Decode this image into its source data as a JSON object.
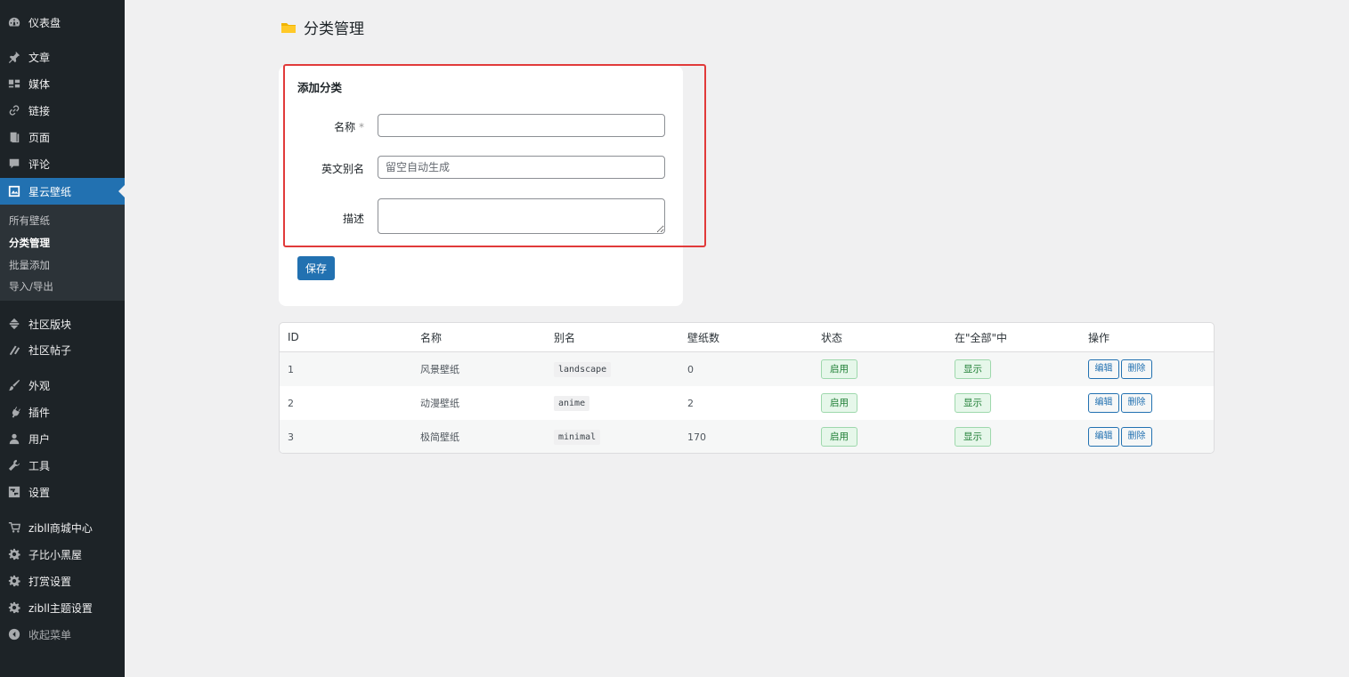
{
  "sidebar": {
    "items": [
      {
        "label": "仪表盘",
        "icon": "dashboard-icon"
      },
      {
        "label": "文章",
        "icon": "pin-icon"
      },
      {
        "label": "媒体",
        "icon": "media-icon"
      },
      {
        "label": "链接",
        "icon": "link-icon"
      },
      {
        "label": "页面",
        "icon": "page-icon"
      },
      {
        "label": "评论",
        "icon": "comment-icon"
      },
      {
        "label": "星云壁纸",
        "icon": "gallery-icon",
        "active": true
      },
      {
        "label": "社区版块",
        "icon": "forum-icon"
      },
      {
        "label": "社区帖子",
        "icon": "posts-icon"
      },
      {
        "label": "外观",
        "icon": "brush-icon"
      },
      {
        "label": "插件",
        "icon": "plugin-icon"
      },
      {
        "label": "用户",
        "icon": "user-icon"
      },
      {
        "label": "工具",
        "icon": "wrench-icon"
      },
      {
        "label": "设置",
        "icon": "settings-icon"
      },
      {
        "label": "zibll商城中心",
        "icon": "cart-icon"
      },
      {
        "label": "子比小黑屋",
        "icon": "gear-icon"
      },
      {
        "label": "打赏设置",
        "icon": "gear-icon"
      },
      {
        "label": "zibll主题设置",
        "icon": "gear-icon"
      },
      {
        "label": "收起菜单",
        "icon": "collapse-icon"
      }
    ],
    "submenu": [
      {
        "label": "所有壁纸"
      },
      {
        "label": "分类管理",
        "current": true
      },
      {
        "label": "批量添加"
      },
      {
        "label": "导入/导出"
      }
    ]
  },
  "page": {
    "title": "分类管理"
  },
  "form": {
    "heading": "添加分类",
    "name_label": "名称",
    "required_mark": "*",
    "name_value": "",
    "slug_label": "英文别名",
    "slug_placeholder": "留空自动生成",
    "desc_label": "描述",
    "desc_value": "",
    "save_label": "保存"
  },
  "table": {
    "headers": [
      "ID",
      "名称",
      "别名",
      "壁纸数",
      "状态",
      "在\"全部\"中",
      "操作"
    ],
    "rows": [
      {
        "id": "1",
        "name": "风景壁纸",
        "slug": "landscape",
        "count": "0",
        "status": "启用",
        "in_all": "显示"
      },
      {
        "id": "2",
        "name": "动漫壁纸",
        "slug": "anime",
        "count": "2",
        "status": "启用",
        "in_all": "显示"
      },
      {
        "id": "3",
        "name": "极简壁纸",
        "slug": "minimal",
        "count": "170",
        "status": "启用",
        "in_all": "显示"
      }
    ],
    "edit_label": "编辑",
    "delete_label": "删除"
  },
  "colors": {
    "sidebar_bg": "#1d2327",
    "accent": "#2271b1",
    "highlight_border": "#e13a3a",
    "status_green": "#1e7e34"
  }
}
